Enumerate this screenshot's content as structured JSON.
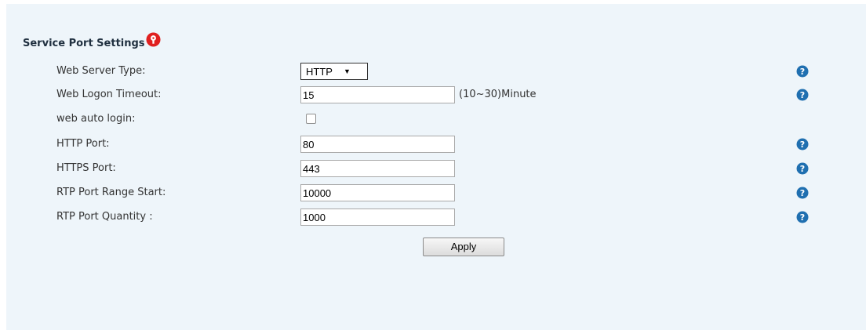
{
  "section": {
    "title": "Service Port Settings",
    "title_icon": "info-alert-icon",
    "title_icon_color": "#e02020"
  },
  "fields": {
    "web_server_type": {
      "label": "Web Server Type:",
      "selected": "HTTP",
      "caret": "▼",
      "help_icon": "help-question-icon"
    },
    "web_logon_timeout": {
      "label": "Web Logon Timeout:",
      "value": "15",
      "hint": "(10~30)Minute",
      "help_icon": "help-question-icon"
    },
    "web_auto_login": {
      "label": "web auto login:",
      "checked": false
    },
    "http_port": {
      "label": "HTTP Port:",
      "value": "80",
      "help_icon": "help-question-icon"
    },
    "https_port": {
      "label": "HTTPS Port:",
      "value": "443",
      "help_icon": "help-question-icon"
    },
    "rtp_port_range_start": {
      "label": "RTP Port Range Start:",
      "value": "10000",
      "help_icon": "help-question-icon"
    },
    "rtp_port_quantity": {
      "label": "RTP Port Quantity :",
      "value": "1000",
      "help_icon": "help-question-icon"
    }
  },
  "actions": {
    "apply_label": "Apply"
  },
  "colors": {
    "panel_background": "#eef5fa",
    "help_icon": "#1f6fb0",
    "alert_icon": "#e02020"
  }
}
